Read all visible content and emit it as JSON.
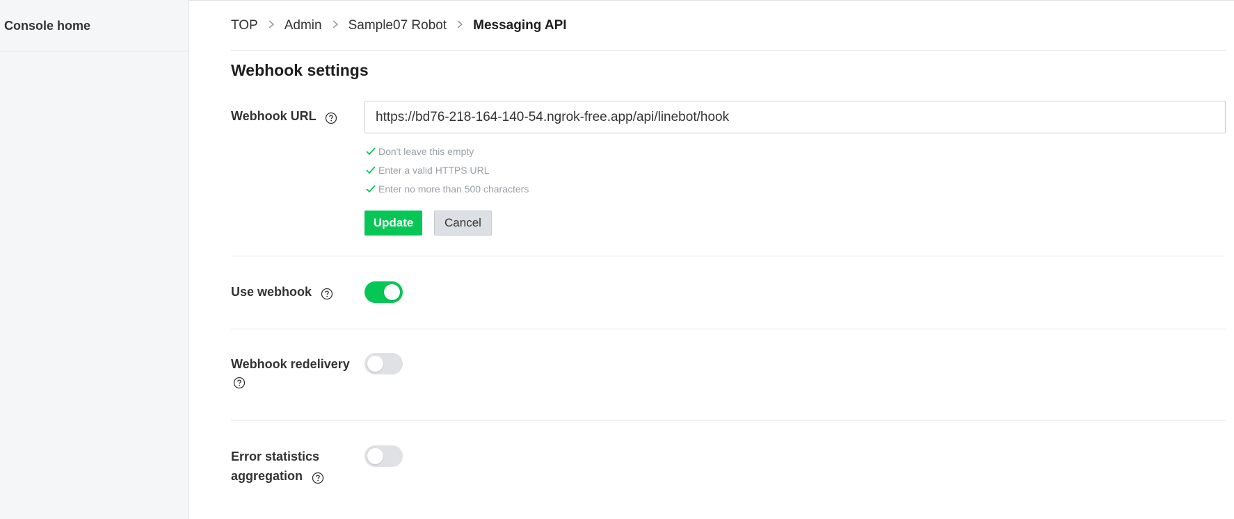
{
  "sidebar": {
    "home_label": "Console home"
  },
  "breadcrumb": {
    "items": [
      "TOP",
      "Admin",
      "Sample07 Robot"
    ],
    "current": "Messaging API",
    "separator": ">"
  },
  "webhook_settings": {
    "title": "Webhook settings",
    "url_field": {
      "label": "Webhook URL",
      "value": "https://bd76-218-164-140-54.ngrok-free.app/api/linebot/hook",
      "validations": [
        "Don't leave this empty",
        "Enter a valid HTTPS URL",
        "Enter no more than 500 characters"
      ],
      "update_label": "Update",
      "cancel_label": "Cancel"
    },
    "use_webhook": {
      "label": "Use webhook",
      "enabled": true
    },
    "webhook_redelivery": {
      "label": "Webhook redelivery",
      "enabled": false
    },
    "error_statistics": {
      "label_line1": "Error statistics",
      "label_line2": "aggregation",
      "enabled": false
    }
  },
  "colors": {
    "accent": "#06c755",
    "toggle_off": "#dfe1e5",
    "sidebar_bg": "#f5f6f7"
  },
  "icons": {
    "help": "help-circle-icon",
    "check": "check-icon",
    "chevron": "chevron-right-icon"
  }
}
